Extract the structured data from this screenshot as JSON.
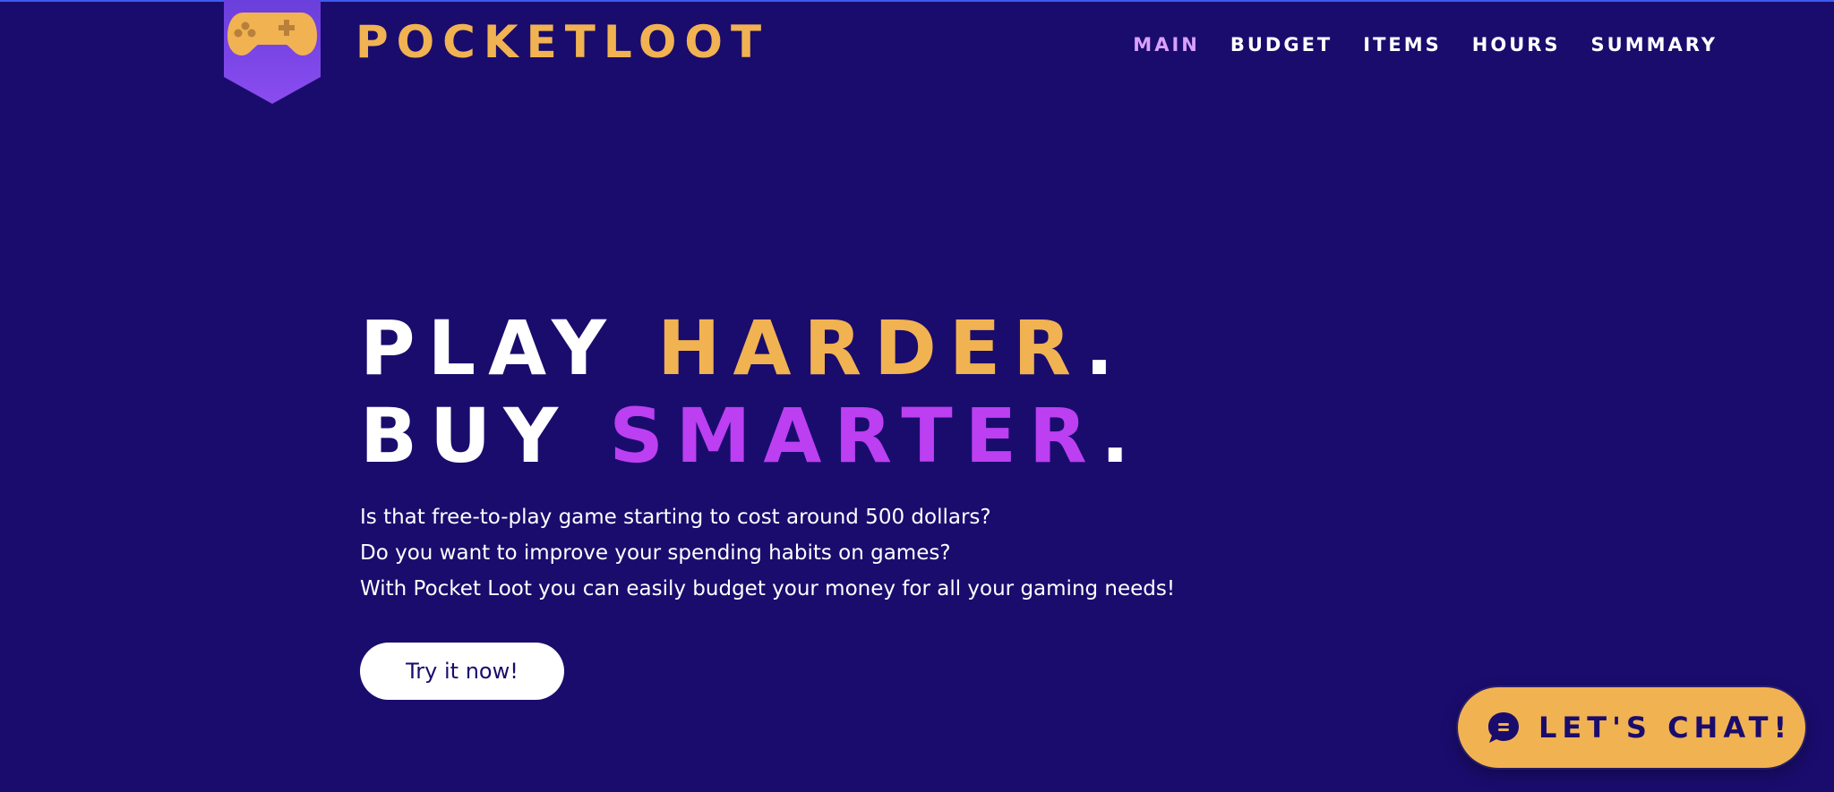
{
  "brand": {
    "name": "POCKETLOOT",
    "logo_icon": "gamepad-icon"
  },
  "nav": {
    "items": [
      {
        "label": "MAIN",
        "active": true
      },
      {
        "label": "BUDGET",
        "active": false
      },
      {
        "label": "ITEMS",
        "active": false
      },
      {
        "label": "HOURS",
        "active": false
      },
      {
        "label": "SUMMARY",
        "active": false
      }
    ]
  },
  "hero": {
    "line1": {
      "prefix": "PLAY ",
      "highlight": "HARDER",
      "suffix": "."
    },
    "line2": {
      "prefix": "BUY ",
      "highlight": "SMARTER",
      "suffix": "."
    },
    "paragraphs": [
      "Is that free-to-play game starting to cost around 500 dollars?",
      "Do you want to improve your spending habits on games?",
      "With Pocket Loot you can easily budget your money for all your gaming needs!"
    ],
    "cta_label": "Try it now!"
  },
  "chat": {
    "label": "LET'S CHAT!",
    "icon": "chat-bubble-icon"
  },
  "colors": {
    "background": "#1a0c6d",
    "accent_orange": "#f1b252",
    "accent_purple": "#bc3ff2",
    "nav_active": "#d9a0ff",
    "badge": "#7b45e6"
  }
}
